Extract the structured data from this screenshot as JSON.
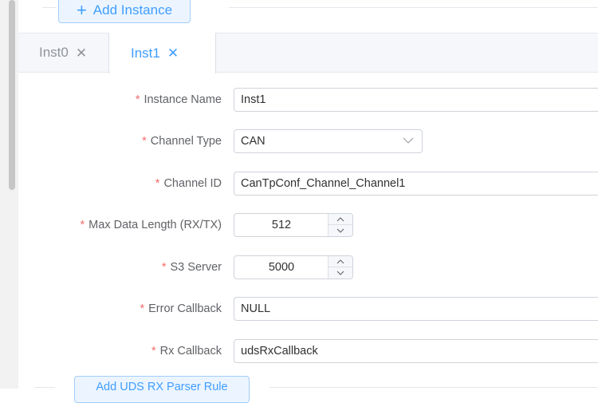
{
  "toolbar": {
    "add_instance_label": "Add Instance"
  },
  "tabs": [
    {
      "label": "Inst0",
      "active": false
    },
    {
      "label": "Inst1",
      "active": true
    }
  ],
  "form": {
    "instance_name": {
      "label": "Instance Name",
      "value": "Inst1"
    },
    "channel_type": {
      "label": "Channel Type",
      "value": "CAN"
    },
    "channel_id": {
      "label": "Channel ID",
      "value": "CanTpConf_Channel_Channel1"
    },
    "max_data_length": {
      "label": "Max Data Length (RX/TX)",
      "value": "512"
    },
    "s3_server": {
      "label": "S3 Server",
      "value": "5000"
    },
    "error_callback": {
      "label": "Error Callback",
      "value": "NULL"
    },
    "rx_callback": {
      "label": "Rx Callback",
      "value": "udsRxCallback"
    }
  },
  "footer": {
    "add_rule_label": "Add UDS RX Parser Rule"
  },
  "colors": {
    "accent": "#409eff",
    "required": "#f56c6c"
  }
}
